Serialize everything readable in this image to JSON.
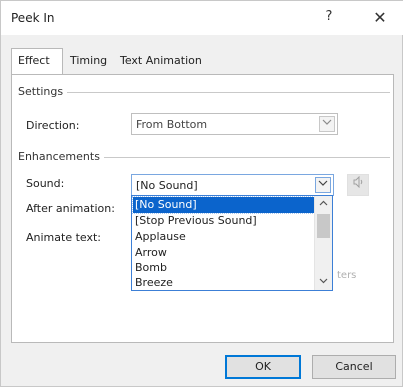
{
  "window": {
    "title": "Peek In",
    "help_glyph": "?",
    "close_glyph": "✕"
  },
  "tabs": [
    {
      "label": "Effect"
    },
    {
      "label": "Timing"
    },
    {
      "label": "Text Animation"
    }
  ],
  "settings": {
    "group_label": "Settings",
    "direction_label": "Direction:",
    "direction_value": "From Bottom"
  },
  "enhancements": {
    "group_label": "Enhancements",
    "sound_label": "Sound:",
    "sound_value": "[No Sound]",
    "after_animation_label": "After animation:",
    "animate_text_label": "Animate text:",
    "partial_hidden_text": "ters"
  },
  "sound_dropdown": {
    "options": [
      "[No Sound]",
      "[Stop Previous Sound]",
      "Applause",
      "Arrow",
      "Bomb",
      "Breeze"
    ],
    "selected_index": 0
  },
  "footer": {
    "ok_label": "OK",
    "cancel_label": "Cancel"
  },
  "icons": {
    "speaker": "speaker-icon",
    "chevron": "chevron-down-icon"
  },
  "colors": {
    "selection": "#0b64cc",
    "accent_border": "#0078d7"
  }
}
